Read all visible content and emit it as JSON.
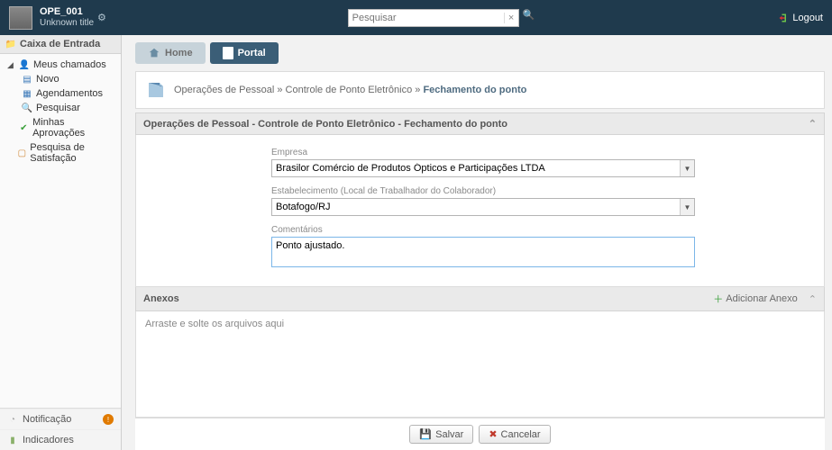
{
  "header": {
    "user_name": "OPE_001",
    "user_title": "Unknown title",
    "search_placeholder": "Pesquisar",
    "logout_label": "Logout"
  },
  "sidebar": {
    "title": "Caixa de Entrada",
    "tree": {
      "root": "Meus chamados",
      "items": [
        "Novo",
        "Agendamentos",
        "Pesquisar"
      ],
      "approvals": "Minhas Aprovações",
      "survey": "Pesquisa de Satisfação"
    },
    "footer": {
      "notification": "Notificação",
      "indicators": "Indicadores"
    }
  },
  "tabs": {
    "home": "Home",
    "portal": "Portal"
  },
  "breadcrumb": {
    "p1": "Operações de Pessoal",
    "p2": "Controle de Ponto Eletrônico",
    "p3": "Fechamento do ponto",
    "sep": "»"
  },
  "panel": {
    "title": "Operações de Pessoal - Controle de Ponto Eletrônico - Fechamento do ponto",
    "fields": {
      "empresa_label": "Empresa",
      "empresa_value": "Brasilor Comércio de Produtos Ópticos e Participações LTDA",
      "estab_label": "Estabelecimento (Local de Trabalhador do Colaborador)",
      "estab_value": "Botafogo/RJ",
      "coment_label": "Comentários",
      "coment_value": "Ponto ajustado."
    }
  },
  "anexos": {
    "title": "Anexos",
    "add_label": "Adicionar Anexo",
    "drop_hint": "Arraste e solte os arquivos aqui"
  },
  "buttons": {
    "save": "Salvar",
    "cancel": "Cancelar"
  }
}
